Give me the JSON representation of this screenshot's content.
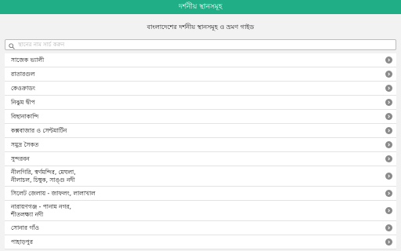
{
  "header": {
    "title": "দর্শনীয় স্থানসমূহ"
  },
  "page": {
    "subtitle": "বাংলাদেশের দর্শনীয় স্থানসমূহ ও ভ্রমণ গাইড"
  },
  "search": {
    "placeholder": "স্থানের নাম সার্চ করুন"
  },
  "list": {
    "items": [
      {
        "label": "সাজেক ভ্যালী"
      },
      {
        "label": "রাতারগুল"
      },
      {
        "label": "কেওক্রাডং"
      },
      {
        "label": "নিঝুম দ্বীপ"
      },
      {
        "label": "বিছানাকান্দি"
      },
      {
        "label": "কক্সবাজার ও সেন্টমার্টিন"
      },
      {
        "label": "সমুদ্র সৈকত"
      },
      {
        "label": "সুন্দরবন"
      },
      {
        "label": "নীলগিরি, স্বর্ণমন্দির, মেঘলা,\nনীলাচল, চিম্বুক, সাঙ্গু নদী"
      },
      {
        "label": "সিলেট জেলায় - জাফলং, লালাখাল"
      },
      {
        "label": "নারায়ণগঞ্জ - পানাম নগর,\nশীতলক্ষ্যা নদী"
      },
      {
        "label": "সোনার গাঁও"
      },
      {
        "label": "পাহাড়পুর"
      }
    ]
  },
  "colors": {
    "appbar": "#1fae85",
    "chevron": "#8a8a8a"
  },
  "icons": {
    "search": "magnifier-icon",
    "row_arrow": "chevron-right-icon"
  }
}
